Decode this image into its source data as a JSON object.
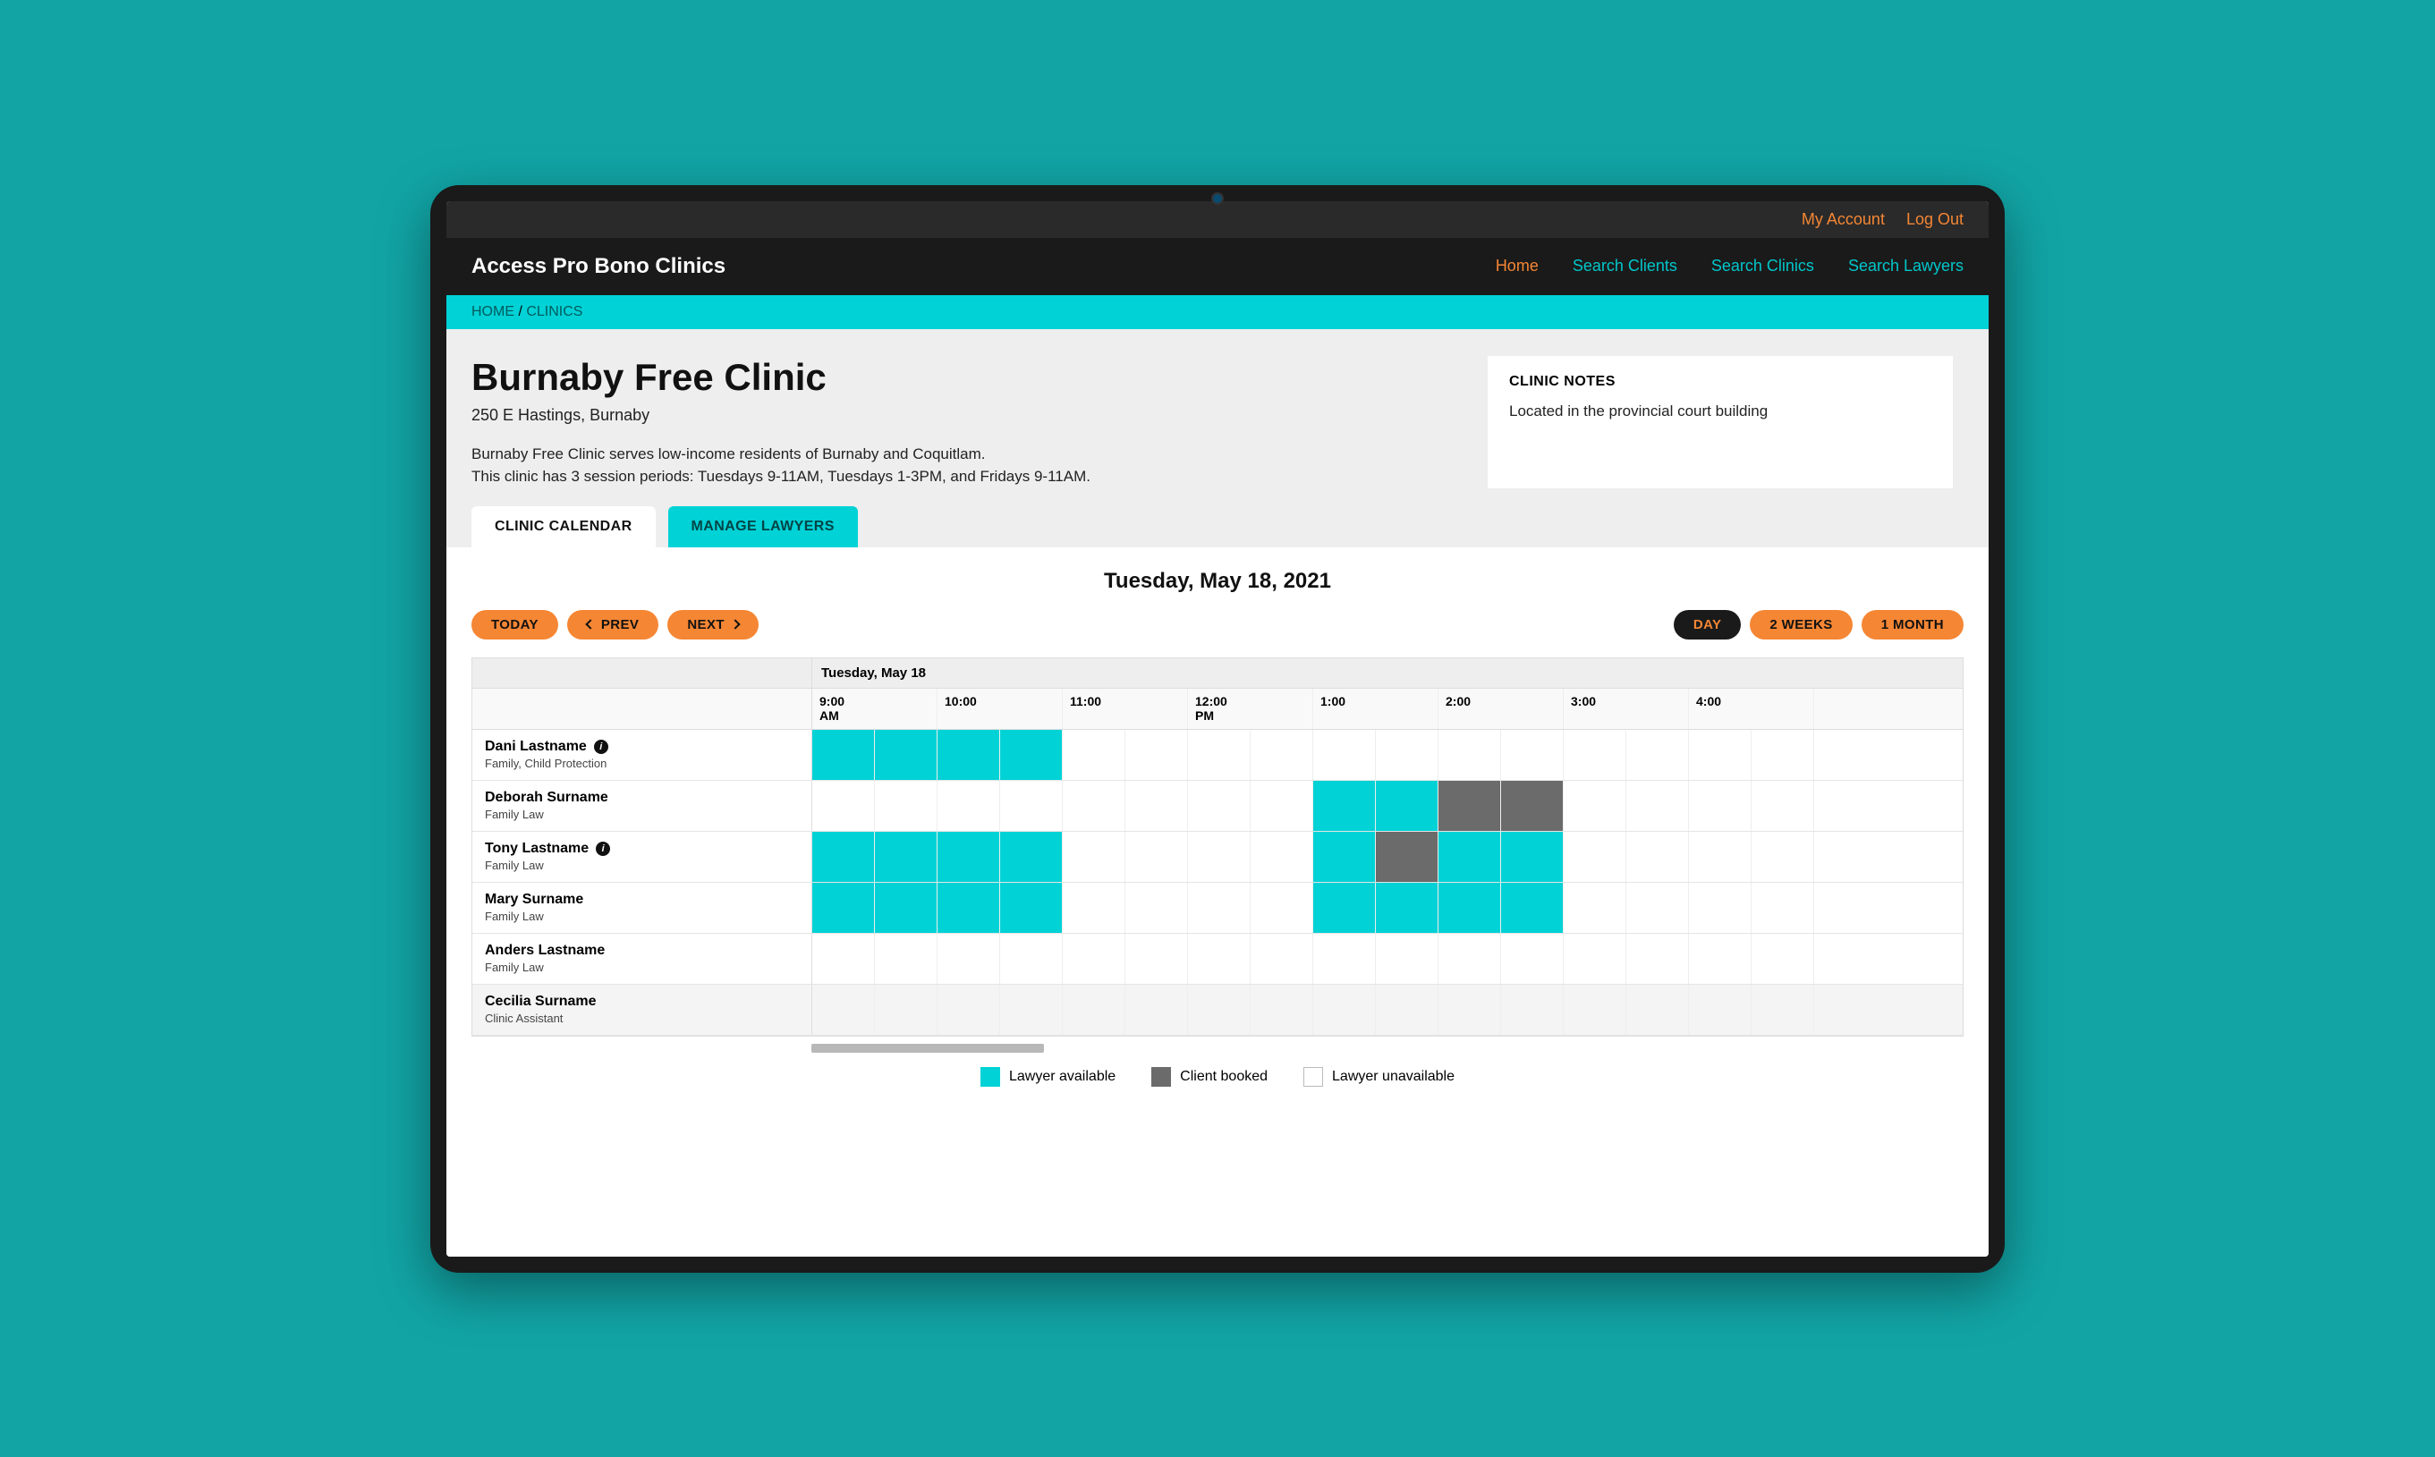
{
  "topbar": {
    "account": "My Account",
    "logout": "Log Out"
  },
  "brand": "Access Pro Bono Clinics",
  "nav": {
    "home": "Home",
    "search_clients": "Search Clients",
    "search_clinics": "Search Clinics",
    "search_lawyers": "Search Lawyers"
  },
  "breadcrumb": {
    "home": "HOME",
    "sep": " / ",
    "current": "CLINICS"
  },
  "clinic": {
    "title": "Burnaby Free Clinic",
    "address": "250 E Hastings, Burnaby",
    "desc1": "Burnaby Free Clinic serves low-income residents of Burnaby and Coquitlam.",
    "desc2": "This clinic has 3 session periods: Tuesdays 9-11AM, Tuesdays 1-3PM, and Fridays 9-11AM."
  },
  "notes": {
    "heading": "CLINIC NOTES",
    "body": "Located in the provincial court building"
  },
  "tabs": {
    "calendar": "CLINIC CALENDAR",
    "lawyers": "MANAGE LAWYERS"
  },
  "calendar": {
    "title": "Tuesday, May 18, 2021",
    "today": "TODAY",
    "prev": "PREV",
    "next": "NEXT",
    "view_day": "DAY",
    "view_2weeks": "2 WEEKS",
    "view_1month": "1 MONTH",
    "date_header": "Tuesday, May 18",
    "hours": [
      "9:00 AM",
      "10:00",
      "11:00",
      "12:00 PM",
      "1:00",
      "2:00",
      "3:00",
      "4:00"
    ],
    "rows": [
      {
        "name": "Dani Lastname",
        "role": "Family, Child Protection",
        "info": true,
        "slots": [
          "avail",
          "avail",
          "avail",
          "avail",
          "",
          "",
          "",
          "",
          "",
          "",
          "",
          "",
          "",
          "",
          "",
          ""
        ]
      },
      {
        "name": "Deborah Surname",
        "role": "Family Law",
        "info": false,
        "slots": [
          "",
          "",
          "",
          "",
          "",
          "",
          "",
          "",
          "avail",
          "avail",
          "booked",
          "booked",
          "",
          "",
          "",
          ""
        ]
      },
      {
        "name": "Tony Lastname",
        "role": "Family Law",
        "info": true,
        "slots": [
          "avail",
          "avail",
          "avail",
          "avail",
          "",
          "",
          "",
          "",
          "avail",
          "booked",
          "avail",
          "avail",
          "",
          "",
          "",
          ""
        ]
      },
      {
        "name": "Mary Surname",
        "role": "Family Law",
        "info": false,
        "slots": [
          "avail",
          "avail",
          "avail",
          "avail",
          "",
          "",
          "",
          "",
          "avail",
          "avail",
          "avail",
          "avail",
          "",
          "",
          "",
          ""
        ]
      },
      {
        "name": "Anders Lastname",
        "role": "Family Law",
        "info": false,
        "slots": [
          "",
          "",
          "",
          "",
          "",
          "",
          "",
          "",
          "",
          "",
          "",
          "",
          "",
          "",
          "",
          ""
        ]
      },
      {
        "name": "Cecilia Surname",
        "role": "Clinic Assistant",
        "info": false,
        "alt": true,
        "slots": [
          "",
          "",
          "",
          "",
          "",
          "",
          "",
          "",
          "",
          "",
          "",
          "",
          "",
          "",
          "",
          ""
        ]
      }
    ]
  },
  "legend": {
    "available": "Lawyer available",
    "booked": "Client booked",
    "unavailable": "Lawyer unavailable"
  }
}
